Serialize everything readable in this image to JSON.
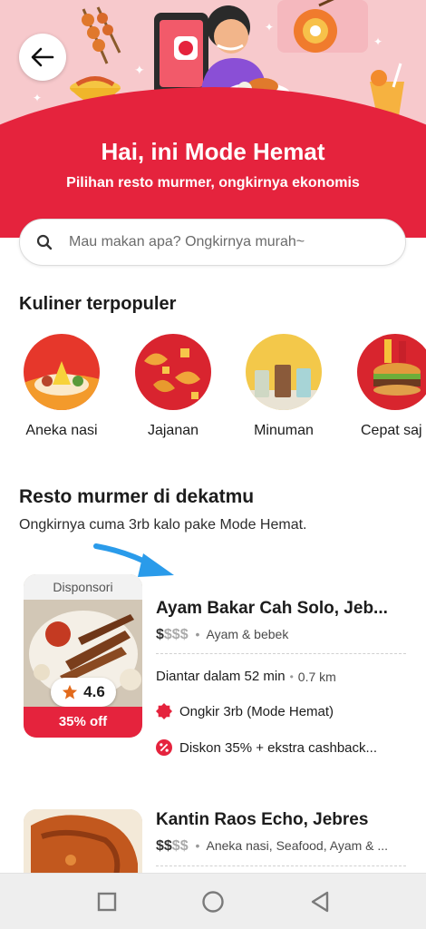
{
  "header": {
    "title": "Hai, ini Mode Hemat",
    "subtitle": "Pilihan resto murmer, ongkirnya ekonomis",
    "back_icon": "arrow-left-icon"
  },
  "search": {
    "placeholder": "Mau makan apa? Ongkirnya murah~",
    "icon": "search-icon"
  },
  "popular": {
    "title": "Kuliner terpopuler",
    "categories": [
      {
        "label": "Aneka nasi"
      },
      {
        "label": "Jajanan"
      },
      {
        "label": "Minuman"
      },
      {
        "label": "Cepat saj"
      }
    ]
  },
  "nearby": {
    "title": "Resto murmer di dekatmu",
    "subtitle": "Ongkirnya cuma 3rb kalo pake Mode Hemat."
  },
  "restaurants": [
    {
      "sponsor_label": "Disponsori",
      "rating": "4.6",
      "discount_badge": "35% off",
      "name": "Ayam Bakar Cah Solo, Jeb...",
      "price_active": "$",
      "price_inactive": "$$$",
      "cuisine": "Ayam & bebek",
      "delivery": "Diantar dalam 52 min",
      "distance": "0.7 km",
      "promo_delivery": "Ongkir 3rb (Mode Hemat)",
      "promo_discount": "Diskon 35% + ekstra cashback..."
    },
    {
      "name": "Kantin Raos Echo, Jebres",
      "price_active": "$$",
      "price_inactive": "$$",
      "cuisine": "Aneka nasi, Seafood, Ayam & ..."
    }
  ],
  "colors": {
    "brand_red": "#e5233d",
    "hero_pink": "#f7c9cc",
    "annotation_arrow": "#2a9bea"
  }
}
